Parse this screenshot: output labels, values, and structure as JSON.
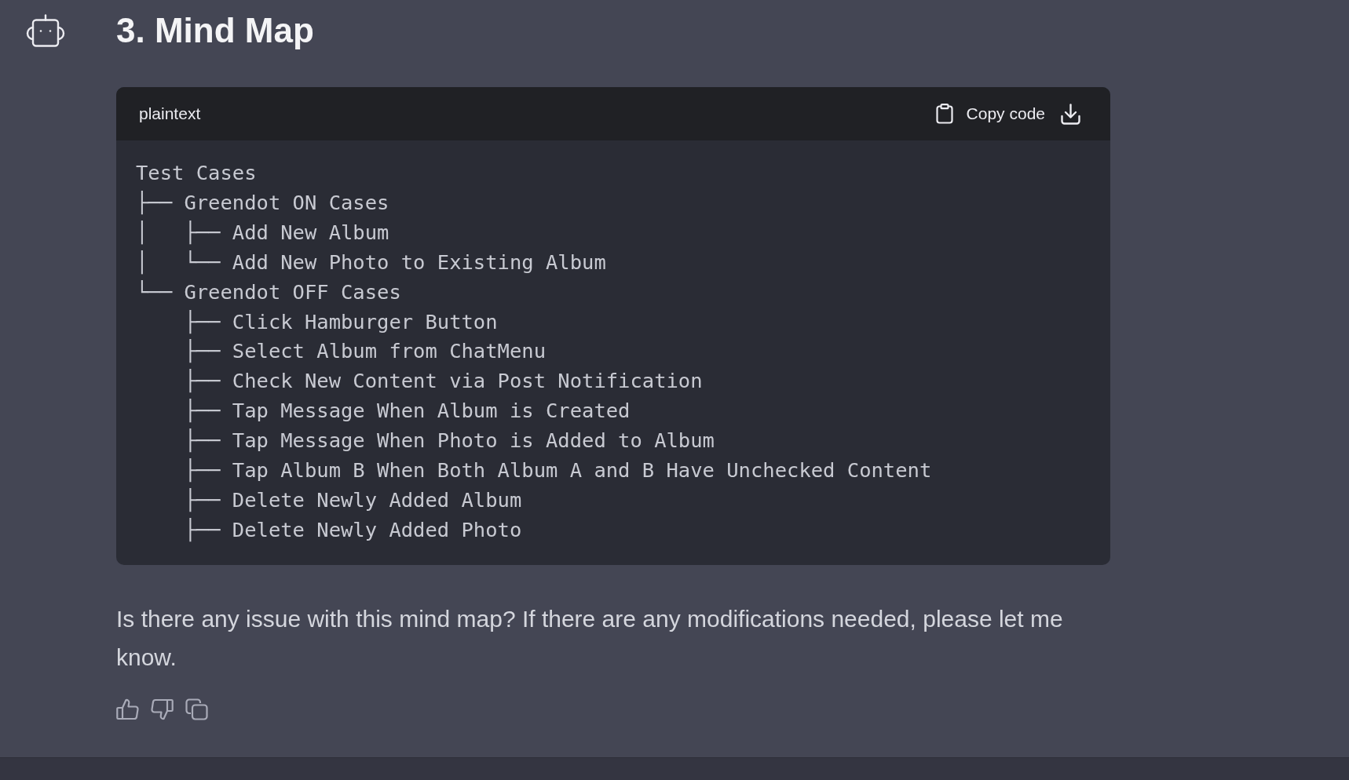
{
  "message": {
    "heading": "3. Mind Map",
    "code_block": {
      "language": "plaintext",
      "copy_label": "Copy code",
      "lines": [
        "Test Cases",
        "├── Greendot ON Cases",
        "│   ├── Add New Album",
        "│   └── Add New Photo to Existing Album",
        "└── Greendot OFF Cases",
        "    ├── Click Hamburger Button",
        "    ├── Select Album from ChatMenu",
        "    ├── Check New Content via Post Notification",
        "    ├── Tap Message When Album is Created",
        "    ├── Tap Message When Photo is Added to Album",
        "    ├── Tap Album B When Both Album A and B Have Unchecked Content",
        "    ├── Delete Newly Added Album",
        "    ├── Delete Newly Added Photo"
      ]
    },
    "text": "Is there any issue with this mind map? If there are any modifications needed, please let me know."
  }
}
